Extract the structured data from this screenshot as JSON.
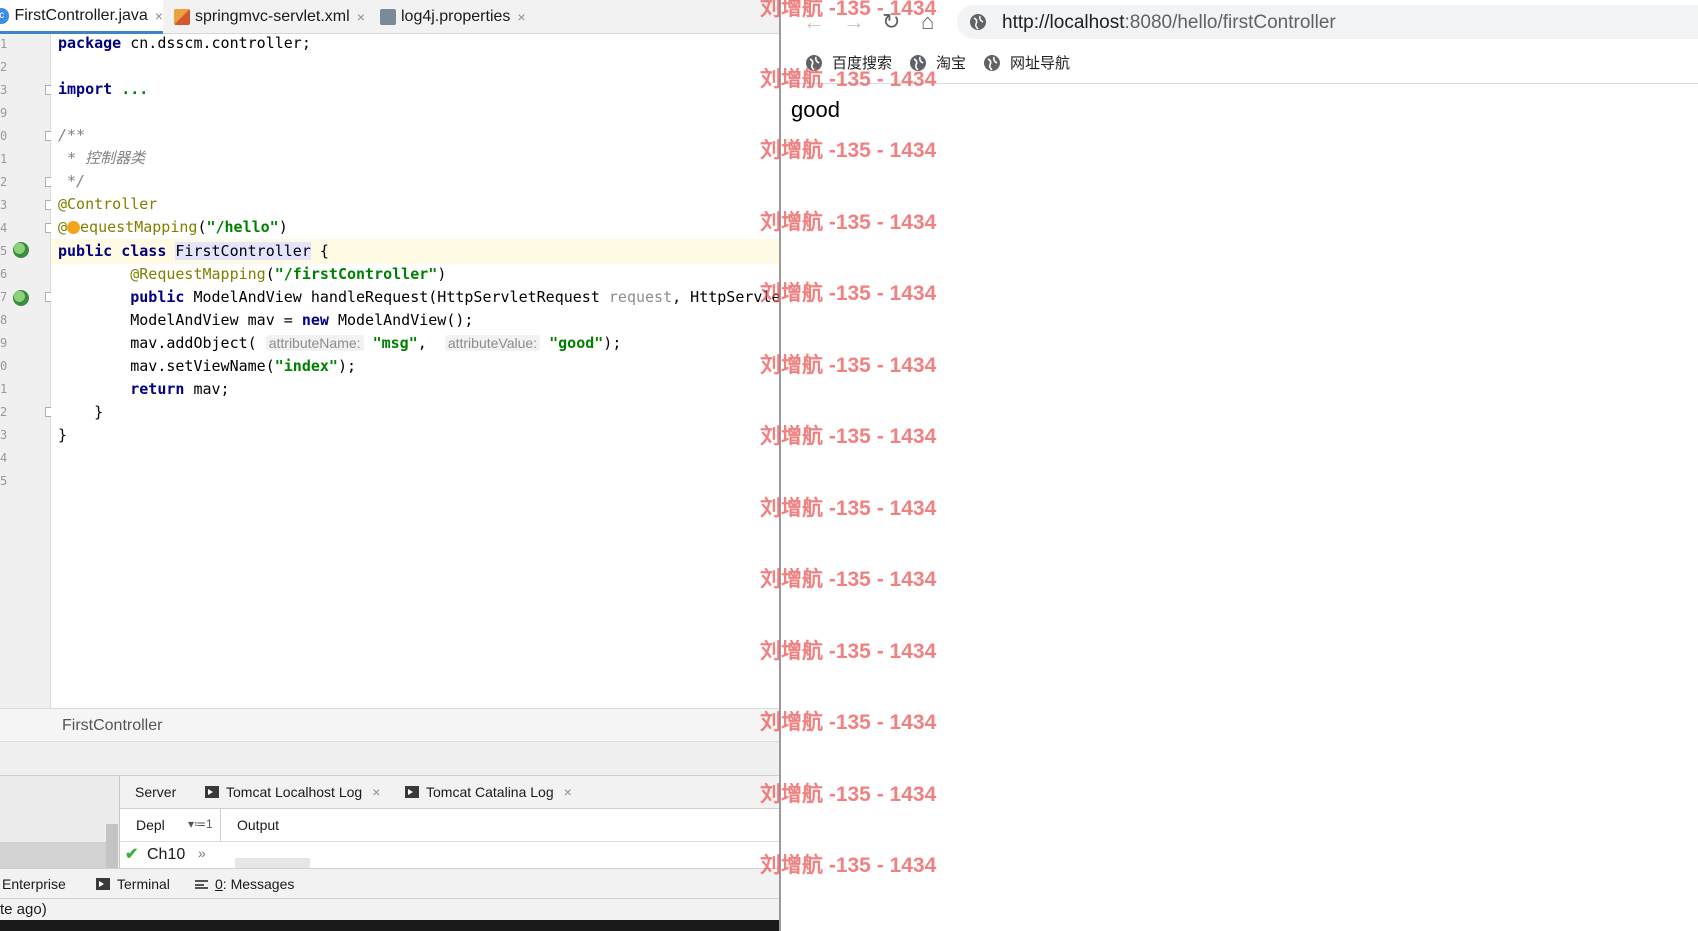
{
  "ide": {
    "tabs": [
      {
        "label": "FirstController.java",
        "close": "×"
      },
      {
        "label": "springmvc-servlet.xml",
        "close": "×"
      },
      {
        "label": "log4j.properties",
        "close": "×"
      }
    ],
    "line_numbers": [
      "1",
      "2",
      "3",
      "9",
      "0",
      "1",
      "2",
      "3",
      "4",
      "5",
      "6",
      "7",
      "8",
      "9",
      "0",
      "1",
      "2",
      "3",
      "4",
      "5"
    ],
    "code": {
      "l1_kw": "package",
      "l1_rest": " cn.dsscm.controller;",
      "l3_kw": "import",
      "l3_rest": " ...",
      "l5": "/**",
      "l6": " * 控制器类",
      "l7": " */",
      "l8": "@Controller",
      "l9_pre": "@",
      "l9_ann": "equestMapping",
      "l9_open": "(",
      "l9_str": "\"/hello\"",
      "l9_close": ")",
      "l10_kw": "public class",
      "l10_sp": " ",
      "l10_name": "FirstController",
      "l10_rest": " {",
      "l11_ind": "        ",
      "l11_ann": "@RequestMapping",
      "l11_open": "(",
      "l11_str": "\"/firstController\"",
      "l11_close": ")",
      "l12_ind": "        ",
      "l12_kw": "public",
      "l12_mid": " ModelAndView handleRequest(HttpServletRequest ",
      "l12_param": "request",
      "l12_tail": ", HttpServle",
      "l13_ind": "        ",
      "l13_pre": "ModelAndView mav = ",
      "l13_kw": "new",
      "l13_rest": " ModelAndView();",
      "l14_ind": "        ",
      "l14_pre": "mav.addObject( ",
      "l14_hint1": "attributeName:",
      "l14_sp1": " ",
      "l14_str1": "\"msg\"",
      "l14_mid": ",  ",
      "l14_hint2": "attributeValue:",
      "l14_sp2": " ",
      "l14_str2": "\"good\"",
      "l14_end": ");",
      "l15_ind": "        ",
      "l15_pre": "mav.setViewName(",
      "l15_str": "\"index\"",
      "l15_end": ");",
      "l16_ind": "        ",
      "l16_kw": "return",
      "l16_rest": " mav;",
      "l17": "    }",
      "l18": "}"
    },
    "breadcrumb": "FirstController",
    "services": {
      "tabs": [
        "Server",
        "Tomcat Localhost Log",
        "Tomcat Catalina Log"
      ],
      "tab_close": "×",
      "deploy_label": "Depl",
      "deploy_ctl": "▾≔1",
      "output_label": "Output",
      "row_check": "✔",
      "row_name": "Ch10",
      "row_more": "»"
    },
    "tool_windows": [
      {
        "label": "Enterprise"
      },
      {
        "label": "Terminal"
      },
      {
        "label_u": "0",
        "label_rest": ": Messages"
      }
    ],
    "status_text": "te ago)"
  },
  "browser": {
    "nav": {
      "back": "←",
      "forward": "→",
      "reload": "↻",
      "home": "⌂"
    },
    "url_host": "http://localhost",
    "url_rest": ":8080/hello/firstController",
    "bookmarks": [
      "百度搜索",
      "淘宝",
      "网址导航"
    ],
    "page_text": "good"
  },
  "watermark": "刘增航 -135 - 1434",
  "icons": {
    "java_file": "java-class-icon",
    "xml_file": "xml-file-icon",
    "props_file": "properties-file-icon",
    "run_gutter": "run-gutter-icon",
    "bulb": "intention-bulb-icon",
    "globe": "globe-icon"
  }
}
